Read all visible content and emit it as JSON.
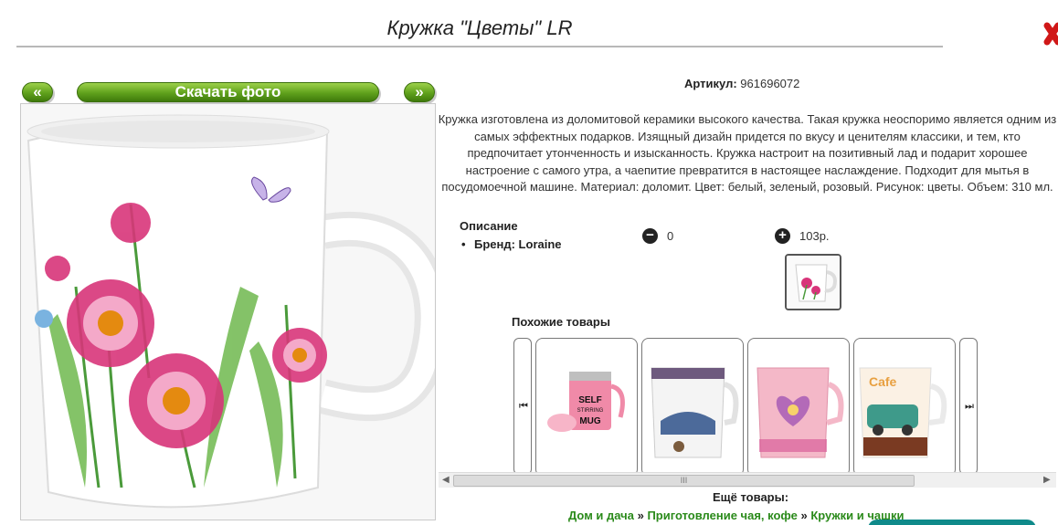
{
  "product": {
    "title": "Кружка \"Цветы\" LR",
    "article_label": "Артикул:",
    "article_value": "961696072",
    "description": "Кружка изготовлена из доломитовой керамики высокого качества. Такая кружка неоспоримо является одним из самых эффектных подарков. Изящный дизайн придется по вкусу и ценителям классики, и тем, кто предпочитает утонченность и изысканность. Кружка настроит на позитивный лад и подарит хорошее настроение с самого утра, а чаепитие превратится в настоящее наслаждение. Подходит для мытья в посудомоечной машине. Материал: доломит. Цвет: белый, зеленый, розовый. Рисунок: цветы. Объем: 310 мл."
  },
  "photo_nav": {
    "prev_label": "«",
    "download_label": "Скачать фото",
    "next_label": "»"
  },
  "specs": {
    "heading": "Описание",
    "items": [
      "Бренд: Loraine"
    ]
  },
  "quantity": {
    "minus_symbol": "−",
    "value": "0",
    "plus_symbol": "+",
    "price": "103р."
  },
  "similar": {
    "heading": "Похожие товары",
    "items": [
      {
        "icon": "self-stirring-mug-image",
        "mug_text": "SELF STIRRING MUG"
      },
      {
        "icon": "car-mug-image"
      },
      {
        "icon": "pink-heart-mug-image"
      },
      {
        "icon": "retro-car-mug-image",
        "mug_text": "Cafe"
      }
    ],
    "scroll_grip": "III"
  },
  "more": {
    "heading": "Ещё товары:",
    "breadcrumbs": [
      "Дом и дача",
      "Приготовление чая, кофе",
      "Кружки и чашки"
    ],
    "separator": "»"
  },
  "colors": {
    "accent_green": "#5fa11c",
    "link_green": "#2a8a1a",
    "close_red": "#d01818"
  }
}
